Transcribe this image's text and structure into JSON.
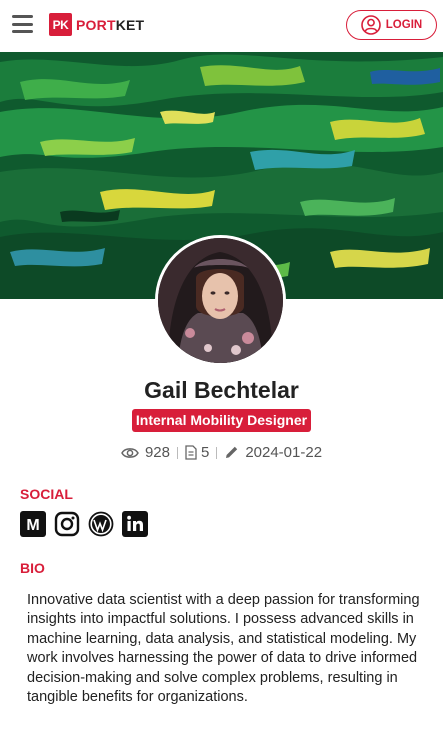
{
  "header": {
    "logo_mark": "PK",
    "logo_brand_a": "PORT",
    "logo_brand_b": "KET",
    "login_label": "LOGIN",
    "menu_icon": "hamburger-menu-icon"
  },
  "profile": {
    "name": "Gail Bechtelar",
    "role": "Internal Mobility Designer",
    "stats": {
      "views": "928",
      "documents": "5",
      "date": "2024-01-22"
    }
  },
  "social": {
    "title": "SOCIAL",
    "links": [
      {
        "icon": "medium-icon"
      },
      {
        "icon": "instagram-icon"
      },
      {
        "icon": "wordpress-icon"
      },
      {
        "icon": "linkedin-icon"
      }
    ]
  },
  "bio": {
    "title": "BIO",
    "text": "Innovative data scientist with a deep passion for transforming insights into impactful solutions. I possess advanced skills in machine learning, data analysis, and statistical modeling. My work involves harnessing the power of data to drive informed decision-making and solve complex problems, resulting in tangible benefits for organizations."
  },
  "colors": {
    "accent": "#d81e3a",
    "text": "#222222",
    "muted": "#555555"
  }
}
